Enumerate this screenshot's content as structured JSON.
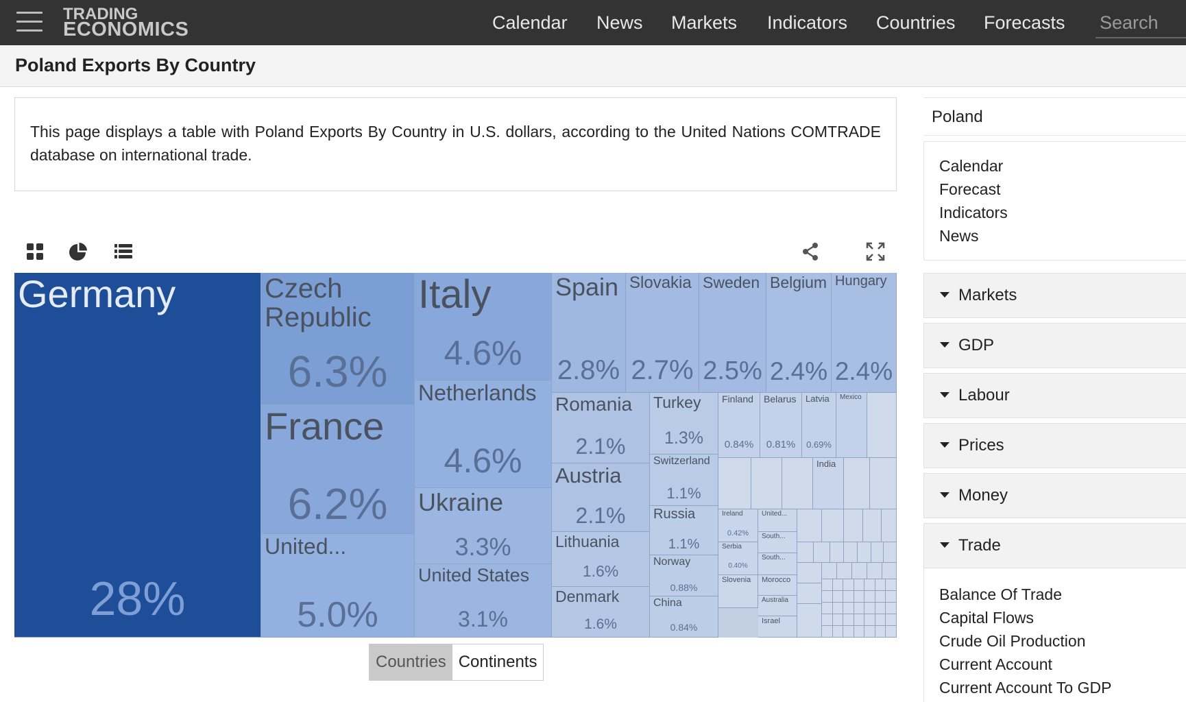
{
  "brand": {
    "line1": "TRADING",
    "line2": "ECONOMICS"
  },
  "nav": [
    "Calendar",
    "News",
    "Markets",
    "Indicators",
    "Countries",
    "Forecasts"
  ],
  "search": {
    "placeholder": "Search"
  },
  "page": {
    "title": "Poland Exports By Country",
    "description": "This page displays a table with Poland Exports By Country in U.S. dollars, according to the United Nations COMTRADE database on international trade."
  },
  "toggle": {
    "countries": "Countries",
    "continents": "Continents",
    "selected": "Countries"
  },
  "sidebar": {
    "country": "Poland",
    "links": [
      "Calendar",
      "Forecast",
      "Indicators",
      "News"
    ],
    "sections": [
      "Markets",
      "GDP",
      "Labour",
      "Prices",
      "Money",
      "Trade"
    ],
    "trade_links": [
      "Balance Of Trade",
      "Capital Flows",
      "Crude Oil Production",
      "Current Account",
      "Current Account To GDP"
    ]
  },
  "chart_data": {
    "type": "treemap",
    "unit": "% of exports",
    "items": [
      {
        "label": "Germany",
        "value": 28,
        "value_label": "28%"
      },
      {
        "label": "Czech Republic",
        "value": 6.3,
        "value_label": "6.3%"
      },
      {
        "label": "France",
        "value": 6.2,
        "value_label": "6.2%"
      },
      {
        "label": "United...",
        "value": 5.0,
        "value_label": "5.0%"
      },
      {
        "label": "Italy",
        "value": 4.6,
        "value_label": "4.6%"
      },
      {
        "label": "Netherlands",
        "value": 4.6,
        "value_label": "4.6%"
      },
      {
        "label": "Ukraine",
        "value": 3.3,
        "value_label": "3.3%"
      },
      {
        "label": "United States",
        "value": 3.1,
        "value_label": "3.1%"
      },
      {
        "label": "Spain",
        "value": 2.8,
        "value_label": "2.8%"
      },
      {
        "label": "Slovakia",
        "value": 2.7,
        "value_label": "2.7%"
      },
      {
        "label": "Sweden",
        "value": 2.5,
        "value_label": "2.5%"
      },
      {
        "label": "Belgium",
        "value": 2.4,
        "value_label": "2.4%"
      },
      {
        "label": "Hungary",
        "value": 2.4,
        "value_label": "2.4%"
      },
      {
        "label": "Romania",
        "value": 2.1,
        "value_label": "2.1%"
      },
      {
        "label": "Austria",
        "value": 2.1,
        "value_label": "2.1%"
      },
      {
        "label": "Lithuania",
        "value": 1.6,
        "value_label": "1.6%"
      },
      {
        "label": "Denmark",
        "value": 1.6,
        "value_label": "1.6%"
      },
      {
        "label": "Turkey",
        "value": 1.3,
        "value_label": "1.3%"
      },
      {
        "label": "Switzerland",
        "value": 1.1,
        "value_label": "1.1%"
      },
      {
        "label": "Russia",
        "value": 1.1,
        "value_label": "1.1%"
      },
      {
        "label": "Norway",
        "value": 0.88,
        "value_label": "0.88%"
      },
      {
        "label": "China",
        "value": 0.84,
        "value_label": "0.84%"
      },
      {
        "label": "Finland",
        "value": 0.84,
        "value_label": "0.84%"
      },
      {
        "label": "Belarus",
        "value": 0.81,
        "value_label": "0.81%"
      },
      {
        "label": "Latvia",
        "value": 0.69,
        "value_label": "0.69%"
      },
      {
        "label": "Mexico",
        "value": null,
        "value_label": ""
      },
      {
        "label": "India",
        "value": null,
        "value_label": ""
      },
      {
        "label": "Ireland",
        "value": 0.42,
        "value_label": "0.42%"
      },
      {
        "label": "Serbia",
        "value": 0.4,
        "value_label": "0.40%"
      },
      {
        "label": "United...",
        "value": null,
        "value_label": ""
      },
      {
        "label": "South...",
        "value": null,
        "value_label": ""
      },
      {
        "label": "South...",
        "value": null,
        "value_label": ""
      },
      {
        "label": "Slovenia",
        "value": null,
        "value_label": ""
      },
      {
        "label": "Morocco",
        "value": null,
        "value_label": ""
      },
      {
        "label": "Australia",
        "value": null,
        "value_label": ""
      },
      {
        "label": "Israel",
        "value": null,
        "value_label": ""
      }
    ]
  }
}
